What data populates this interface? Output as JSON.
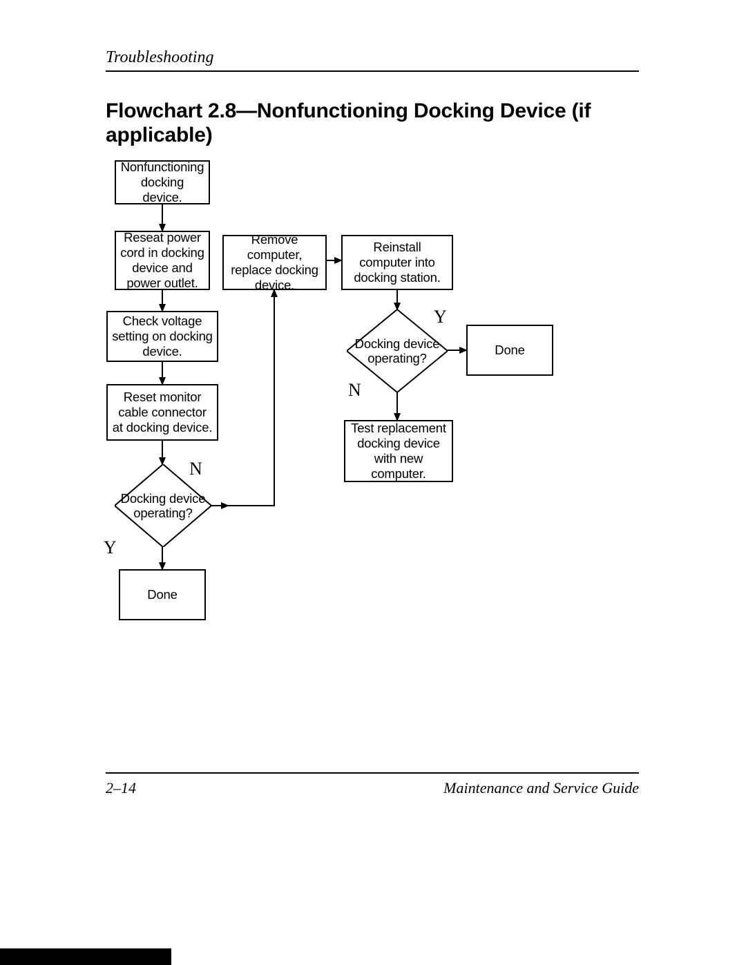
{
  "header": {
    "section": "Troubleshooting"
  },
  "title": "Flowchart 2.8—Nonfunctioning Docking Device (if applicable)",
  "footer": {
    "page": "2–14",
    "guide": "Maintenance and Service Guide"
  },
  "nodes": {
    "start": "Nonfunctioning docking device.",
    "reseat": "Reseat power cord in docking device and power outlet.",
    "voltage": "Check voltage setting on docking device.",
    "monitor": "Reset monitor cable connector at docking device.",
    "d1": "Docking device operating?",
    "done1": "Done",
    "remove": "Remove computer, replace docking device.",
    "reinstall": "Reinstall computer into docking station.",
    "d2": "Docking device operating?",
    "done2": "Done",
    "test": "Test replacement docking device with new computer."
  },
  "labels": {
    "yes": "Y",
    "no": "N"
  },
  "chart_data": {
    "type": "flowchart",
    "nodes": [
      {
        "id": "start",
        "kind": "process",
        "text": "Nonfunctioning docking device."
      },
      {
        "id": "reseat",
        "kind": "process",
        "text": "Reseat power cord in docking device and power outlet."
      },
      {
        "id": "voltage",
        "kind": "process",
        "text": "Check voltage setting on docking device."
      },
      {
        "id": "monitor",
        "kind": "process",
        "text": "Reset monitor cable connector at docking device."
      },
      {
        "id": "d1",
        "kind": "decision",
        "text": "Docking device operating?"
      },
      {
        "id": "done1",
        "kind": "terminal",
        "text": "Done"
      },
      {
        "id": "remove",
        "kind": "process",
        "text": "Remove computer, replace docking device."
      },
      {
        "id": "reinstall",
        "kind": "process",
        "text": "Reinstall computer into docking station."
      },
      {
        "id": "d2",
        "kind": "decision",
        "text": "Docking device operating?"
      },
      {
        "id": "done2",
        "kind": "terminal",
        "text": "Done"
      },
      {
        "id": "test",
        "kind": "process",
        "text": "Test replacement docking device with new computer."
      }
    ],
    "edges": [
      {
        "from": "start",
        "to": "reseat"
      },
      {
        "from": "reseat",
        "to": "voltage"
      },
      {
        "from": "voltage",
        "to": "monitor"
      },
      {
        "from": "monitor",
        "to": "d1"
      },
      {
        "from": "d1",
        "to": "done1",
        "label": "Y"
      },
      {
        "from": "d1",
        "to": "remove",
        "label": "N"
      },
      {
        "from": "remove",
        "to": "reinstall"
      },
      {
        "from": "reinstall",
        "to": "d2"
      },
      {
        "from": "d2",
        "to": "done2",
        "label": "Y"
      },
      {
        "from": "d2",
        "to": "test",
        "label": "N"
      }
    ]
  }
}
